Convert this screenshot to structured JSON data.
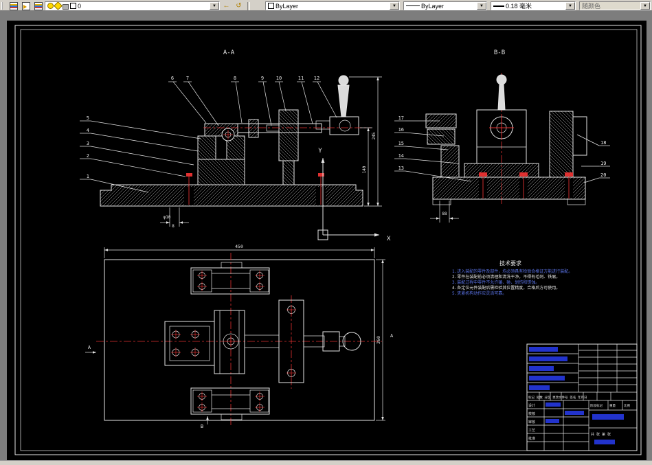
{
  "toolbar": {
    "layer_value": "0",
    "color_value": "ByLayer",
    "linetype_value": "ByLayer",
    "lineweight_value": "0.18 毫米",
    "plotstyle_value": "随颜色",
    "dropdown_arrow": "▼"
  },
  "drawing": {
    "section_a_title": "A-A",
    "section_b_title": "B-B",
    "axis": {
      "x": "X",
      "y": "Y"
    },
    "callouts": {
      "aa_top": [
        "6",
        "7",
        "8",
        "9",
        "10",
        "11",
        "12"
      ],
      "aa_left": [
        "5",
        "4",
        "3",
        "2",
        "1"
      ],
      "bb_left": [
        "17",
        "16",
        "15",
        "14",
        "13"
      ],
      "bb_right": [
        "18",
        "19",
        "20"
      ]
    },
    "dimensions": {
      "aa_total_height": "245",
      "aa_lower_height": "140",
      "aa_hole": "φ10",
      "aa_hole_fit": "8",
      "bb_base": "88",
      "plan_width": "450",
      "plan_depth": "260"
    },
    "section_marks": {
      "left": "A",
      "right": "A",
      "bottom": "B"
    },
    "tech_requirements": {
      "title": "技术要求",
      "lines": [
        "1.进入装配的零件及部件，均必须具有检验合格证方能进行装配。",
        "2.零件在装配前必须清理和清洗干净，不得有毛刺、铁屑。",
        "3.装配过程中零件不允许磕、碰、划伤和锈蚀。",
        "4.各定位元件装配后需检验其位置精度，合格后方可使用。",
        "5.夹紧机构动作应灵活可靠。"
      ]
    },
    "title_block": {
      "left_rows": [
        "设计",
        "校核",
        "审核",
        "工艺",
        "批准"
      ],
      "header_row": "标记 处数 分区 更改文件号 签名 年月日",
      "stage_label": "阶段标记",
      "weight_label": "重量",
      "scale_label": "比例",
      "sheet_label": "共 张 第 张"
    }
  }
}
